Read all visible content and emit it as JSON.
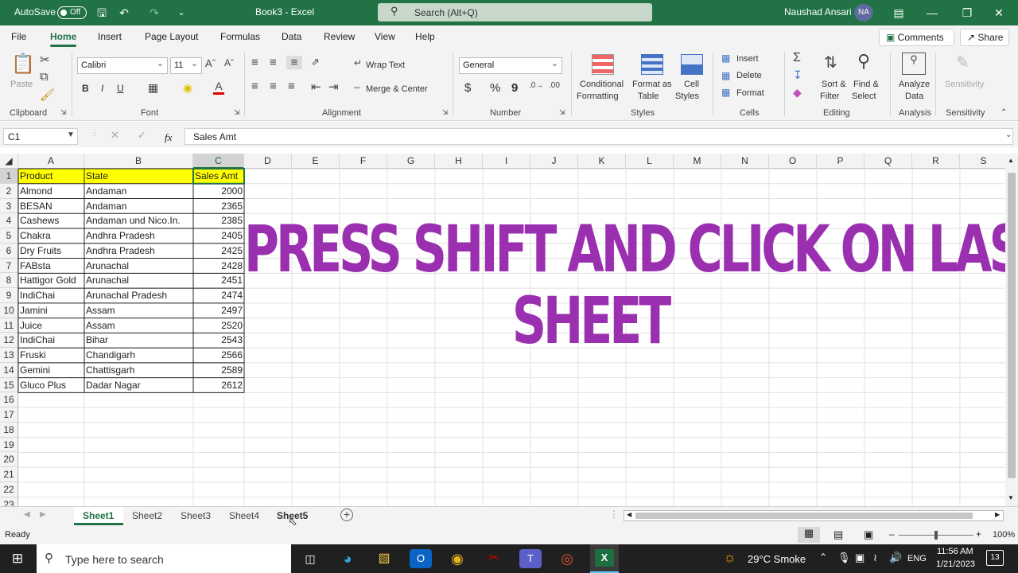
{
  "titlebar": {
    "autosave_label": "AutoSave",
    "autosave_state": "Off",
    "doc_title": "Book3 - Excel",
    "search_placeholder": "Search (Alt+Q)",
    "user_name": "Naushad Ansari",
    "user_initials": "NA"
  },
  "tabs": [
    "File",
    "Home",
    "Insert",
    "Page Layout",
    "Formulas",
    "Data",
    "Review",
    "View",
    "Help"
  ],
  "active_tab": "Home",
  "top_buttons": {
    "comments": "Comments",
    "share": "Share"
  },
  "ribbon": {
    "clipboard": {
      "paste": "Paste",
      "label": "Clipboard"
    },
    "font": {
      "family": "Calibri",
      "size": "11",
      "label": "Font",
      "bold": "B",
      "italic": "I",
      "underline": "U"
    },
    "alignment": {
      "wrap": "Wrap Text",
      "merge": "Merge & Center",
      "label": "Alignment"
    },
    "number": {
      "format": "General",
      "label": "Number",
      "currency": "$",
      "percent": "%",
      "comma": "9"
    },
    "styles": {
      "conditional_1": "Conditional",
      "conditional_2": "Formatting",
      "format_table_1": "Format as",
      "format_table_2": "Table",
      "cell_styles_1": "Cell",
      "cell_styles_2": "Styles",
      "label": "Styles"
    },
    "cells": {
      "insert": "Insert",
      "delete": "Delete",
      "format": "Format",
      "label": "Cells"
    },
    "editing": {
      "sort_1": "Sort &",
      "sort_2": "Filter",
      "find_1": "Find &",
      "find_2": "Select",
      "label": "Editing"
    },
    "analysis": {
      "analyze_1": "Analyze",
      "analyze_2": "Data",
      "label": "Analysis"
    },
    "sensitivity": {
      "btn": "Sensitivity",
      "label": "Sensitivity"
    }
  },
  "formula_bar": {
    "name_box": "C1",
    "fx": "fx",
    "content": "Sales Amt"
  },
  "columns": [
    "A",
    "B",
    "C",
    "D",
    "E",
    "F",
    "G",
    "H",
    "I",
    "J",
    "K",
    "L",
    "M",
    "N",
    "O",
    "P",
    "Q",
    "R",
    "S"
  ],
  "row_numbers": [
    "1",
    "2",
    "3",
    "4",
    "5",
    "6",
    "7",
    "8",
    "9",
    "10",
    "11",
    "12",
    "13",
    "14",
    "15",
    "16",
    "17",
    "18",
    "19",
    "20",
    "21",
    "22",
    "23"
  ],
  "table": {
    "headers": [
      "Product",
      "State",
      "Sales Amt"
    ],
    "rows": [
      [
        "Almond",
        "Andaman",
        "2000"
      ],
      [
        "BESAN",
        "Andaman",
        "2365"
      ],
      [
        "Cashews",
        "Andaman und Nico.In.",
        "2385"
      ],
      [
        "Chakra",
        "Andhra Pradesh",
        "2405"
      ],
      [
        "Dry Fruits",
        "Andhra Pradesh",
        "2425"
      ],
      [
        "FABsta",
        "Arunachal",
        "2428"
      ],
      [
        "Hattigor Gold",
        "Arunachal",
        "2451"
      ],
      [
        "IndiChai",
        "Arunachal Pradesh",
        "2474"
      ],
      [
        "Jamini",
        "Assam",
        "2497"
      ],
      [
        "Juice",
        "Assam",
        "2520"
      ],
      [
        "IndiChai",
        "Bihar",
        "2543"
      ],
      [
        "Fruski",
        "Chandigarh",
        "2566"
      ],
      [
        "Gemini",
        "Chattisgarh",
        "2589"
      ],
      [
        "Gluco Plus",
        "Dadar Nagar",
        "2612"
      ]
    ]
  },
  "overlay": {
    "line1": "PRESS SHIFT AND CLICK ON LAST",
    "line2": "SHEET",
    "color": "#9a2fb0"
  },
  "sheets": [
    "Sheet1",
    "Sheet2",
    "Sheet3",
    "Sheet4",
    "Sheet5"
  ],
  "active_sheet": "Sheet1",
  "status": {
    "ready": "Ready",
    "zoom": "100%"
  },
  "taskbar": {
    "search_placeholder": "Type here to search",
    "weather": "29°C Smoke",
    "lang": "ENG",
    "time": "11:56 AM",
    "date": "1/21/2023",
    "notifications": "13"
  },
  "colors": {
    "excel_green": "#217346",
    "header_fill": "#ffff00"
  }
}
